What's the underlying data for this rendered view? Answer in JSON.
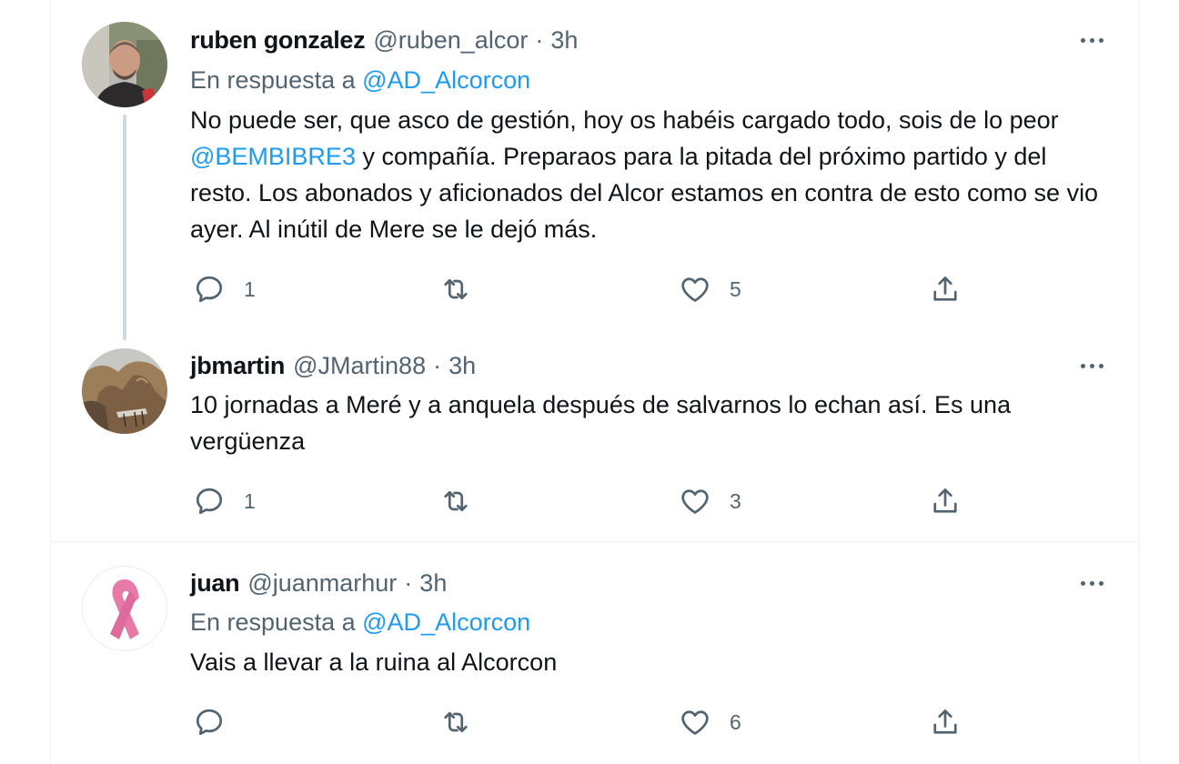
{
  "tweets": [
    {
      "name": "ruben gonzalez",
      "handle": "@ruben_alcor",
      "time": "3h",
      "reply_prefix": "En respuesta a",
      "reply_to": "@AD_Alcorcon",
      "text_before": "No puede ser, que asco de gestión, hoy os habéis cargado todo, sois de lo peor ",
      "mention": "@BEMBIBRE3",
      "text_after": " y compañía. Preparaos para la pitada del próximo partido y del resto. Los abonados y aficionados del Alcor estamos en contra de esto como se vio ayer. Al inútil de Mere se le dejó más.",
      "replies": "1",
      "likes": "5"
    },
    {
      "name": "jbmartin",
      "handle": "@JMartin88",
      "time": "3h",
      "text": "10 jornadas a Meré y a anquela después de salvarnos lo echan así. Es una vergüenza",
      "replies": "1",
      "likes": "3"
    },
    {
      "name": "juan",
      "handle": "@juanmarhur",
      "time": "3h",
      "reply_prefix": "En respuesta a",
      "reply_to": "@AD_Alcorcon",
      "text": "Vais a llevar a la ruina al Alcorcon",
      "likes": "6"
    }
  ],
  "separator": "·",
  "colors": {
    "primary_text": "#0f1419",
    "secondary_text": "#536471",
    "link": "#1d9bf0",
    "thread_line": "#cfd9de",
    "divider": "#eff3f4",
    "ribbon": "#e87aa8"
  },
  "icons": [
    "reply-icon",
    "retweet-icon",
    "like-icon",
    "share-icon",
    "more-icon"
  ]
}
